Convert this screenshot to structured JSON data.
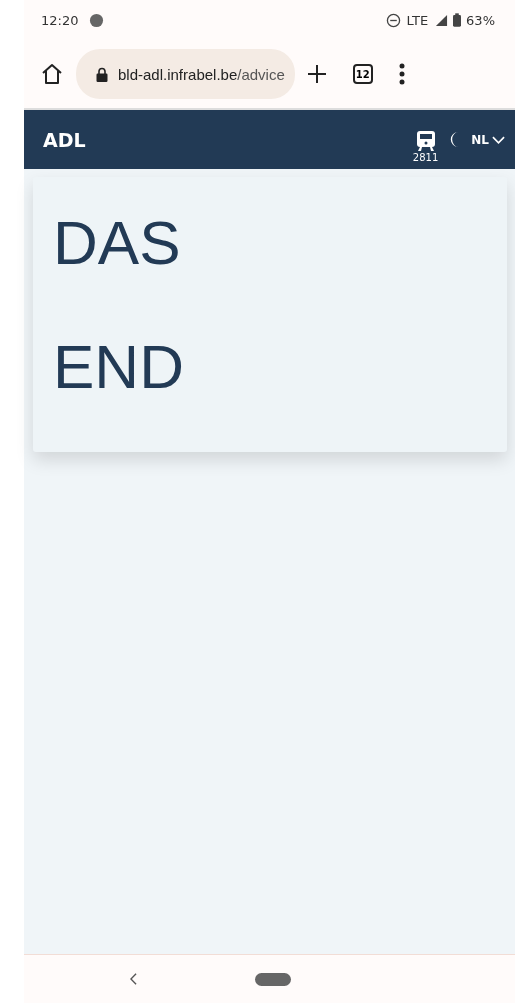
{
  "status_bar": {
    "time": "12:20",
    "network": "LTE",
    "battery": "63%"
  },
  "browser": {
    "url_host": "bld-adl.infrabel.be",
    "url_path": "/advice",
    "tab_count": "12"
  },
  "header": {
    "title": "ADL",
    "train_number": "2811",
    "language": "NL"
  },
  "card": {
    "lines": [
      "DAS",
      "END"
    ]
  }
}
